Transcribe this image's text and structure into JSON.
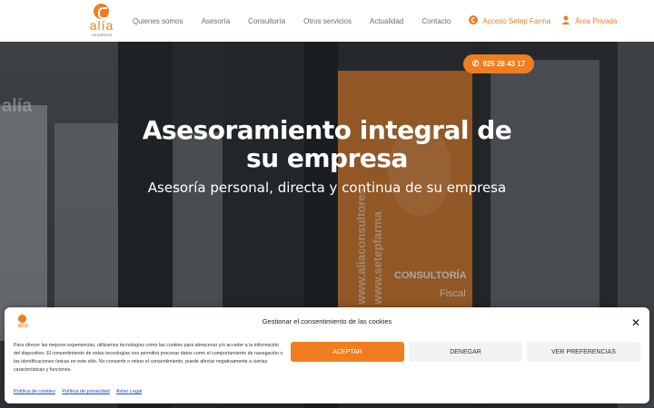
{
  "brand": {
    "logo_text": "alía",
    "logo_subtext": "consultores",
    "accent": "#f07d1f"
  },
  "nav": {
    "items": [
      {
        "label": "Quienes somos"
      },
      {
        "label": "Asesoría"
      },
      {
        "label": "Consultoría"
      },
      {
        "label": "Otros servicios"
      },
      {
        "label": "Actualidad"
      },
      {
        "label": "Contacto"
      }
    ],
    "setep_label": "Acceso Setep Farma",
    "private_label": "Área Privada"
  },
  "hero": {
    "phone": "925 28 43 17",
    "title": "Asesoramiento integral de su empresa",
    "subtitle": "Asesoría personal, directa y continua de su empresa",
    "bg_text": {
      "window_left": "alía",
      "window_consultoria": "CONSULTORÍA",
      "window_fiscal": "Fiscal",
      "window_url1": "www.aliaconsultores",
      "window_url2": "www.setepfarma"
    }
  },
  "cookie": {
    "title": "Gestionar el consentimiento de las cookies",
    "body": "Para ofrecer las mejores experiencias, utilizamos tecnologías como las cookies para almacenar y/o acceder a la información del dispositivo. El consentimiento de estas tecnologías nos permitirá procesar datos como el comportamiento de navegación o las identificaciones únicas en este sitio. No consentir o retirar el consentimiento, puede afectar negativamente a ciertas características y funciones.",
    "accept_label": "ACEPTAR",
    "deny_label": "DENEGAR",
    "prefs_label": "VER PREFERENCIAS",
    "links": [
      "Política de cookies",
      "Política de privacidad",
      "Aviso Legal"
    ],
    "close_icon": "close-icon"
  }
}
